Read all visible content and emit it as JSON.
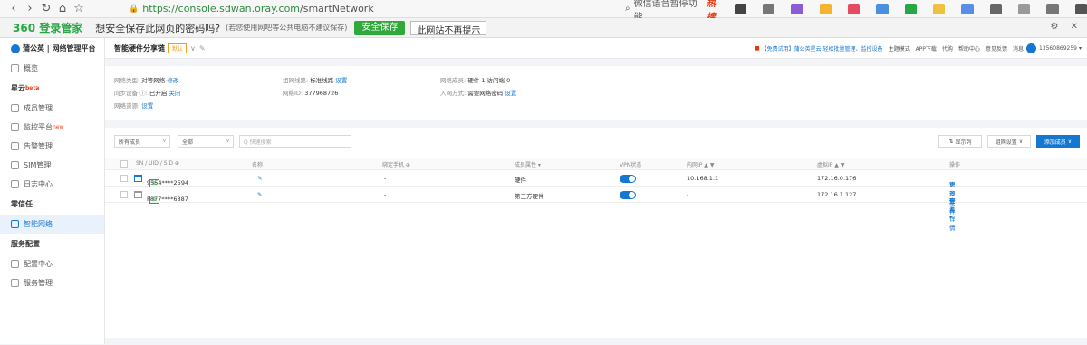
{
  "browser": {
    "url_green": "https://console.sdwan.oray.com",
    "url_rest": "/smartNetwork",
    "search_hint": "微信语音暂停功能",
    "hot_label": "热搜"
  },
  "password_bar": {
    "logo": "360 登录管家",
    "question": "想安全保存此网页的密码吗?",
    "hint": "(若您使用网吧等公共电脑不建议保存)",
    "save_btn": "安全保存",
    "no_prompt_btn": "此网站不再提示"
  },
  "sidebar": {
    "brand": "蒲公英 | 网络管理平台",
    "items": [
      {
        "label": "概览"
      },
      {
        "label": "星云",
        "badge": "beta",
        "section": true
      },
      {
        "label": "成员管理"
      },
      {
        "label": "监控平台",
        "badge": "new"
      },
      {
        "label": "告警管理"
      },
      {
        "label": "SIM管理"
      },
      {
        "label": "日志中心"
      },
      {
        "label": "零信任",
        "section": true
      },
      {
        "label": "智能网络",
        "active": true
      },
      {
        "label": "服务配置",
        "section": true
      },
      {
        "label": "配置中心"
      },
      {
        "label": "服务管理"
      }
    ]
  },
  "topbar": {
    "title": "智能硬件分享链",
    "default_tag": "默认",
    "promo": "【免费试用】蒲公英星云,轻松批量管理、监控设备",
    "links": [
      "主题模式",
      "APP下载",
      "代购",
      "帮助中心",
      "意见反馈",
      "消息"
    ],
    "phone": "13560869259"
  },
  "info": {
    "network_type_label": "网络类型:",
    "network_type_value": "对等网络",
    "network_type_action": "修改",
    "sync_label": "同步设备 ⓘ:",
    "sync_value": "已开启",
    "sync_action": "关闭",
    "resource_label": "网络资源:",
    "resource_action": "设置",
    "line_label": "组网线路:",
    "line_value": "标准线路",
    "line_action": "设置",
    "id_label": "网络ID:",
    "id_value": "377968726",
    "members_label": "网络成员:",
    "members_value": "硬件 1  访问端 0",
    "join_label": "入网方式:",
    "join_value": "需要网络密码",
    "join_action": "设置"
  },
  "filters": {
    "member_select": "所有成员",
    "status_select": "全部",
    "search_placeholder": "Q 快速搜索",
    "columns_btn": "显示列",
    "net_settings_btn": "组网设置",
    "add_member_btn": "添加成员"
  },
  "table": {
    "headers": [
      "SN / UID / SID ⊕",
      "名称",
      "绑定手机 ⊕",
      "成员属性 ▾",
      "VPN状态",
      "内网IP ▲ ▼",
      "虚拟IP ▲ ▼",
      "操作"
    ],
    "rows": [
      {
        "sn": "9554****2594",
        "tag": "新",
        "name_edit": "✎",
        "phone": "-",
        "attr": "硬件",
        "vpn_on": true,
        "lan_ip": "10.168.1.1",
        "vip": "172.16.0.176",
        "op1": "管理硬件",
        "op2": "更多 ▾"
      },
      {
        "sn": "P877****6887",
        "tag": "新",
        "name_edit": "✎",
        "phone": "-",
        "attr": "第三方硬件",
        "vpn_on": true,
        "lan_ip": "-",
        "vip": "172.16.1.127",
        "op1": "查看详情",
        "op2": "更多 ▾"
      }
    ]
  },
  "watermark": {
    "title": "路由器",
    "domain": "luyouqi.com"
  },
  "colors": {
    "accent": "#1677d2",
    "save_green": "#31a83a",
    "hot_red": "#e8380d"
  }
}
